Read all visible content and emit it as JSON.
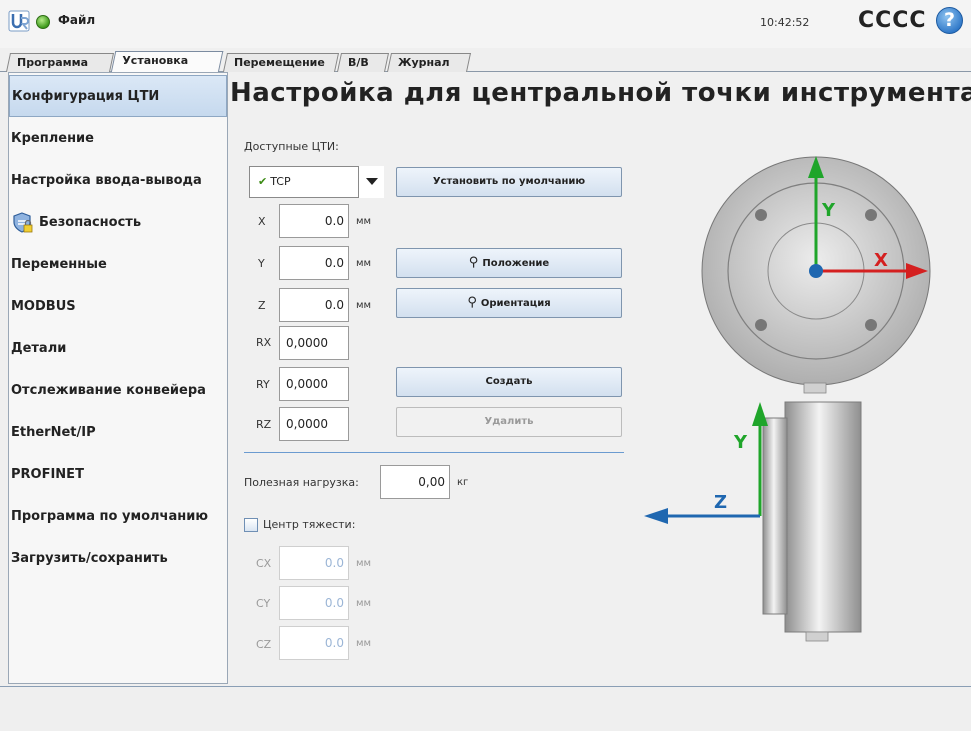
{
  "header": {
    "file_menu": "Файл",
    "clock": "10:42:52",
    "robot_name": "CCCC",
    "help": "?"
  },
  "tabs": [
    {
      "label": "Программа",
      "active": false
    },
    {
      "label": "Установка",
      "active": true
    },
    {
      "label": "Перемещение",
      "active": false
    },
    {
      "label": "В/В",
      "active": false
    },
    {
      "label": "Журнал",
      "active": false
    }
  ],
  "sidebar": {
    "items": [
      {
        "label": "Конфигурация ЦТИ",
        "active": true
      },
      {
        "label": "Крепление"
      },
      {
        "label": "Настройка ввода-вывода"
      },
      {
        "label": "Безопасность"
      },
      {
        "label": "Переменные"
      },
      {
        "label": "MODBUS"
      },
      {
        "label": "Детали"
      },
      {
        "label": "Отслеживание конвейера"
      },
      {
        "label": "EtherNet/IP"
      },
      {
        "label": "PROFINET"
      },
      {
        "label": "Программа по умолчанию"
      },
      {
        "label": "Загрузить/сохранить"
      }
    ]
  },
  "main": {
    "title": "Настройка для центральной точки инструмента",
    "available_label": "Доступные ЦТИ:",
    "tcp_selected": "TCP",
    "set_default_button": "Установить по умолчанию",
    "position_button": "Положение",
    "orientation_button": "Ориентация",
    "create_button": "Создать",
    "delete_button": "Удалить",
    "fields": {
      "x": {
        "label": "X",
        "value": "0.0",
        "unit": "мм"
      },
      "y": {
        "label": "Y",
        "value": "0.0",
        "unit": "мм"
      },
      "z": {
        "label": "Z",
        "value": "0.0",
        "unit": "мм"
      },
      "rx": {
        "label": "RX",
        "value": "0,0000"
      },
      "ry": {
        "label": "RY",
        "value": "0,0000"
      },
      "rz": {
        "label": "RZ",
        "value": "0,0000"
      }
    },
    "payload": {
      "label": "Полезная нагрузка:",
      "value": "0,00",
      "unit": "кг"
    },
    "cog": {
      "label": "Центр тяжести:",
      "checked": false,
      "cx": {
        "label": "CX",
        "value": "0.0",
        "unit": "мм"
      },
      "cy": {
        "label": "CY",
        "value": "0.0",
        "unit": "мм"
      },
      "cz": {
        "label": "CZ",
        "value": "0.0",
        "unit": "мм"
      }
    },
    "diagram": {
      "x_axis": "X",
      "y_axis_top": "Y",
      "y_axis_side": "Y",
      "z_axis": "Z"
    }
  },
  "colors": {
    "accent": "#c6d9ee",
    "x_axis": "#d42020",
    "y_axis": "#1fa52a",
    "z_axis": "#1f67b0"
  }
}
